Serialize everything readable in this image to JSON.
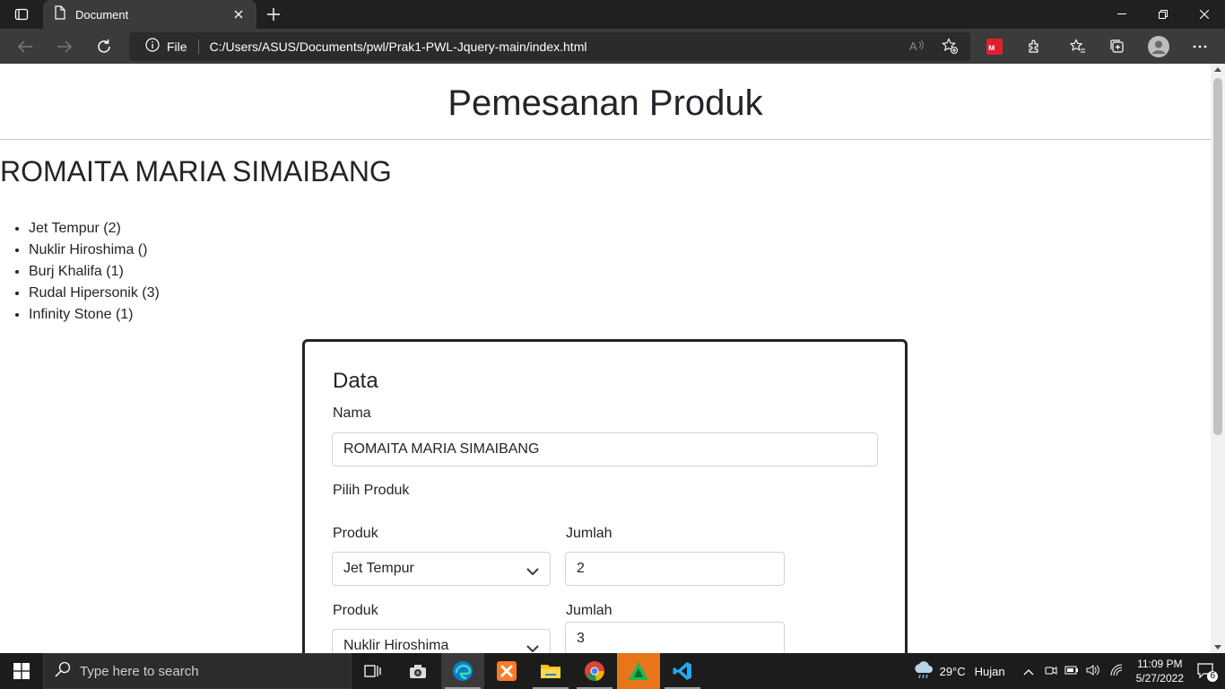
{
  "browser": {
    "tab_title": "Document",
    "address_scheme_label": "File",
    "address_url": "C:/Users/ASUS/Documents/pwl/Prak1-PWL-Jquery-main/index.html"
  },
  "page": {
    "title": "Pemesanan Produk",
    "user_name": "ROMAITA MARIA SIMAIBANG",
    "product_list": [
      "Jet Tempur (2)",
      "Nuklir Hiroshima ()",
      "Burj Khalifa (1)",
      "Rudal Hipersonik (3)",
      "Infinity Stone (1)"
    ],
    "form": {
      "heading": "Data",
      "name_label": "Nama",
      "name_value": "ROMAITA MARIA SIMAIBANG",
      "choose_label": "Pilih Produk",
      "rows": [
        {
          "product_label": "Produk",
          "product_value": "Jet Tempur",
          "qty_label": "Jumlah",
          "qty_value": "2"
        },
        {
          "product_label": "Produk",
          "product_value": "Nuklir Hiroshima",
          "qty_label": "Jumlah",
          "qty_value": "3"
        }
      ]
    }
  },
  "taskbar": {
    "search_placeholder": "Type here to search",
    "weather_temp": "29°C",
    "weather_desc": "Hujan",
    "time": "11:09 PM",
    "date": "5/27/2022",
    "notification_count": "6"
  }
}
